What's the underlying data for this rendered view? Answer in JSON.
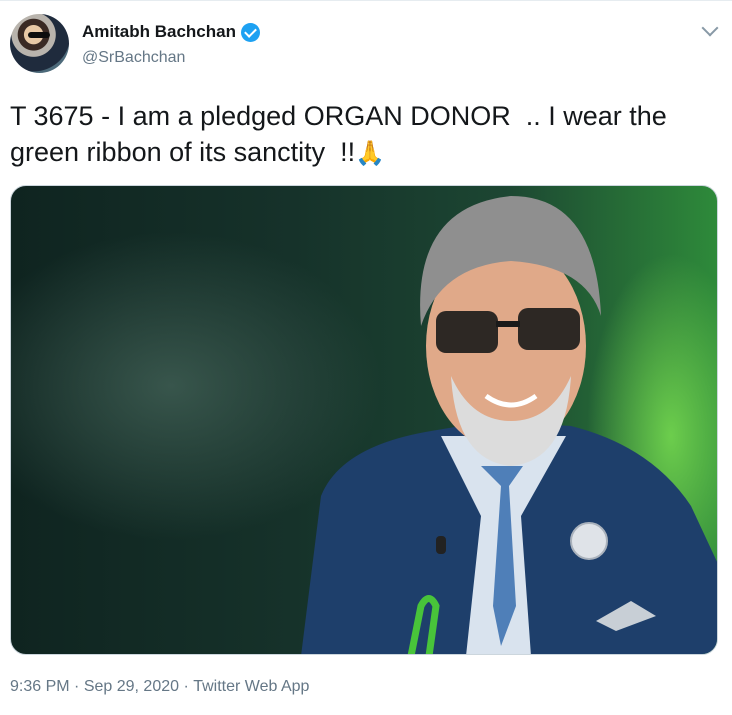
{
  "tweet": {
    "display_name": "Amitabh Bachchan",
    "handle": "@SrBachchan",
    "text": "T 3675 - I am a pledged ORGAN DONOR  .. I wear the green ribbon of its sanctity  !!",
    "emoji": "🙏",
    "time": "9:36 PM",
    "date": "Sep 29, 2020",
    "source": "Twitter Web App",
    "separator": " · "
  },
  "icons": {
    "verified": "verified-badge-icon",
    "more": "chevron-down-icon",
    "emoji": "folded-hands-icon"
  },
  "colors": {
    "verified_blue": "#1da1f2",
    "secondary_text": "#657786",
    "primary_text": "#14171a"
  }
}
